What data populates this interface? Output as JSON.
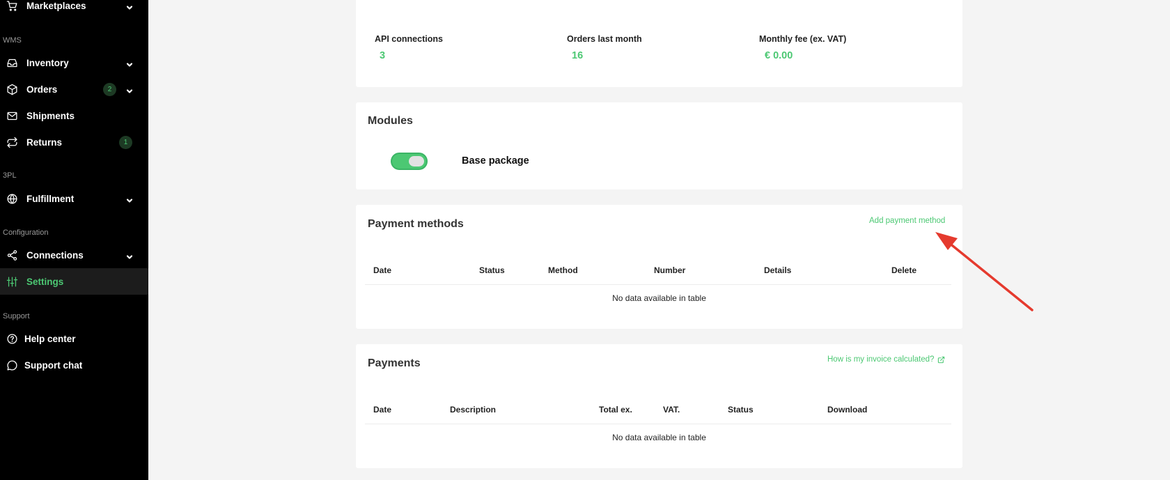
{
  "sidebar": {
    "marketplaces": "Marketplaces",
    "section_wms": "WMS",
    "inventory": "Inventory",
    "orders": "Orders",
    "orders_badge": "2",
    "shipments": "Shipments",
    "returns": "Returns",
    "returns_badge": "1",
    "section_3pl": "3PL",
    "fulfillment": "Fulfillment",
    "section_configuration": "Configuration",
    "connections": "Connections",
    "settings": "Settings",
    "section_support": "Support",
    "help_center": "Help center",
    "support_chat": "Support chat"
  },
  "stats": {
    "api_label": "API connections",
    "api_value": "3",
    "orders_label": "Orders last month",
    "orders_value": "16",
    "fee_label": "Monthly fee (ex. VAT)",
    "fee_value": "€ 0.00"
  },
  "modules": {
    "title": "Modules",
    "base_package": "Base package"
  },
  "payment_methods": {
    "title": "Payment methods",
    "add_link": "Add payment method",
    "columns": [
      "Date",
      "Status",
      "Method",
      "Number",
      "Details",
      "Delete"
    ],
    "empty": "No data available in table"
  },
  "payments": {
    "title": "Payments",
    "invoice_link": "How is my invoice calculated?",
    "columns": [
      "Date",
      "Description",
      "Total ex.",
      "VAT.",
      "Status",
      "Download"
    ],
    "empty": "No data available in table"
  },
  "colors": {
    "accent": "#4cc873",
    "sidebar_bg": "#000000",
    "annotation_arrow": "#e53a2e"
  }
}
